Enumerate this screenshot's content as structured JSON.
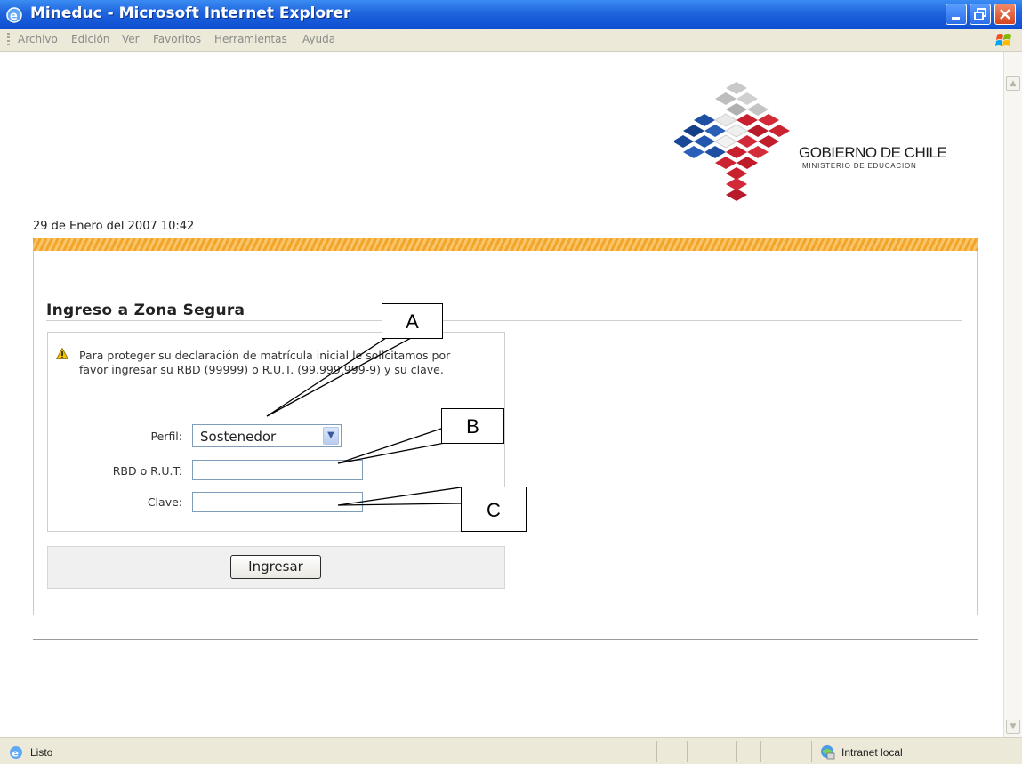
{
  "window": {
    "title": "Mineduc - Microsoft Internet Explorer"
  },
  "menu": {
    "items": [
      "Archivo",
      "Edición",
      "Ver",
      "Favoritos",
      "Herramientas",
      "Ayuda"
    ]
  },
  "branding": {
    "title": "GOBIERNO DE CHILE",
    "subtitle": "MINISTERIO DE EDUCACION"
  },
  "page": {
    "date": "29 de Enero del 2007 10:42",
    "heading": "Ingreso a Zona Segura",
    "notice": "Para proteger su declaración de matrícula inicial le solicitamos por favor ingresar su RBD (99999) o R.U.T. (99.999.999-9) y su clave."
  },
  "form": {
    "perfil_label": "Perfil:",
    "perfil_value": "Sostenedor",
    "rut_label": "RBD o R.U.T:",
    "rut_value": "",
    "clave_label": "Clave:",
    "clave_value": "",
    "submit_label": "Ingresar"
  },
  "callouts": {
    "a": "A",
    "b": "B",
    "c": "C"
  },
  "status": {
    "text": "Listo",
    "zone": "Intranet local"
  }
}
